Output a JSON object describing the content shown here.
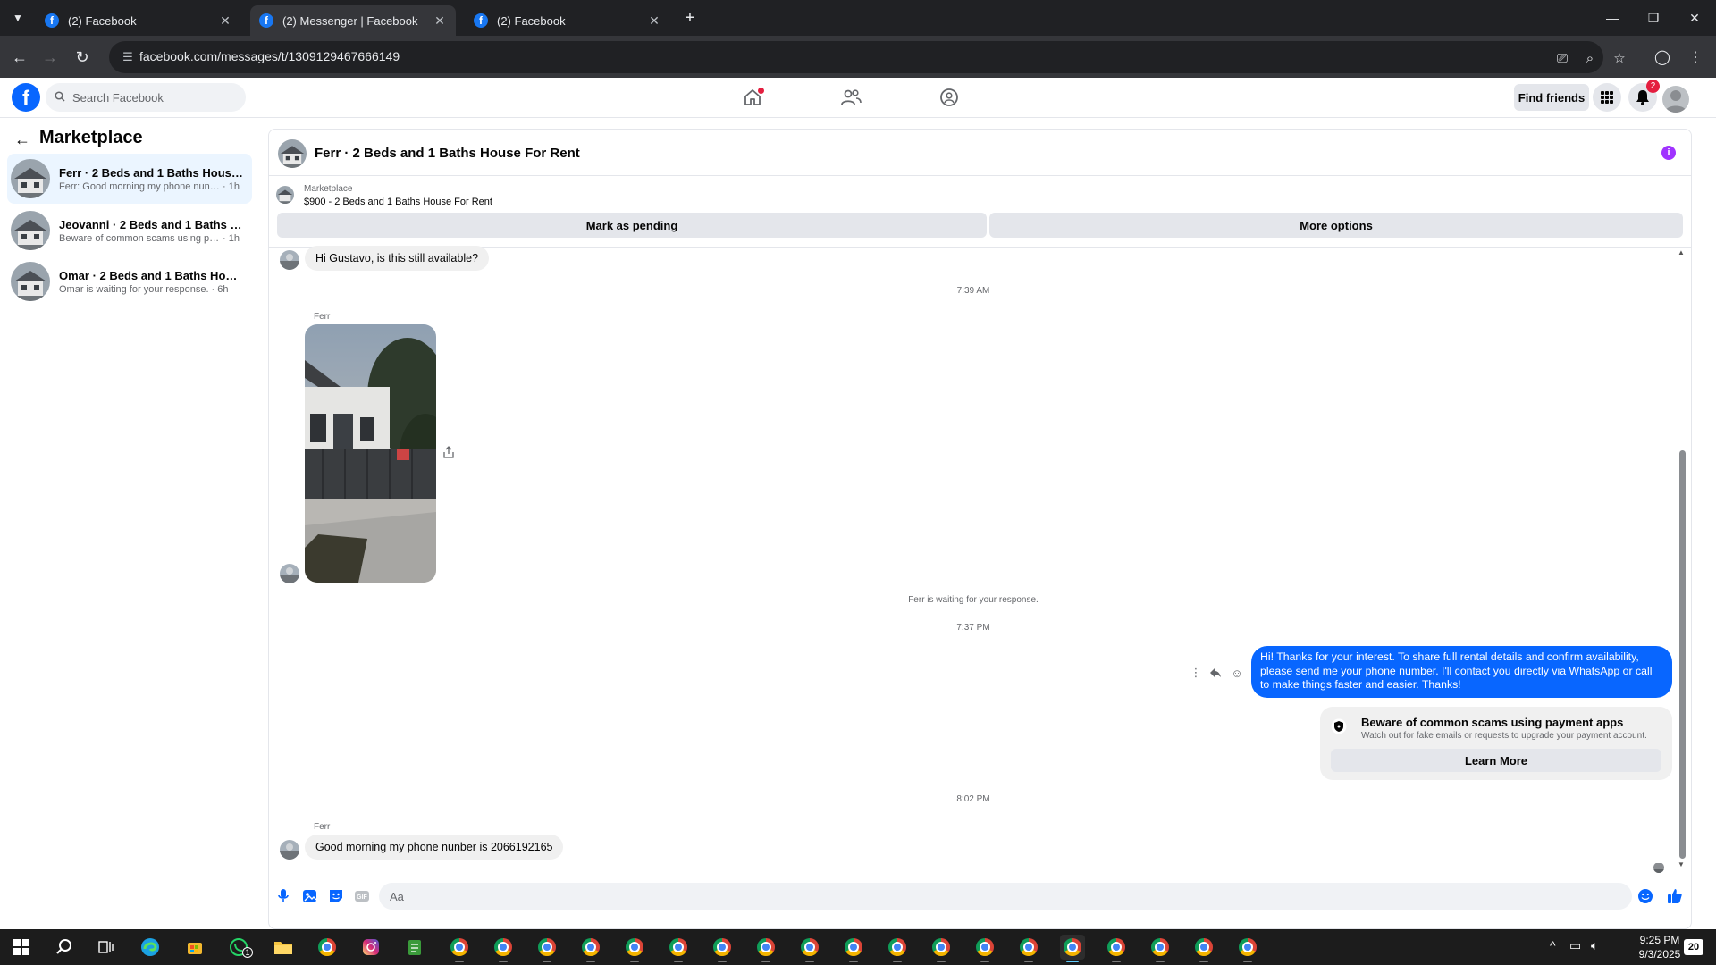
{
  "browser": {
    "tabs": [
      {
        "title": "(2) Facebook",
        "active": false
      },
      {
        "title": "(2) Messenger | Facebook",
        "active": true
      },
      {
        "title": "(2) Facebook",
        "active": false
      }
    ],
    "url": "facebook.com/messages/t/1309129467666149"
  },
  "fb_header": {
    "search_placeholder": "Search Facebook",
    "find_friends_label": "Find friends",
    "notification_count": "2"
  },
  "sidebar": {
    "title": "Marketplace",
    "conversations": [
      {
        "title": "Ferr · 2 Beds and 1 Baths House Fo...",
        "preview": "Ferr: Good morning my phone nunbe...",
        "time": "· 1h",
        "active": true
      },
      {
        "title": "Jeovanni · 2 Beds and 1 Baths Hou...",
        "preview": "Beware of common scams using pay...",
        "time": "· 1h",
        "active": false
      },
      {
        "title": "Omar · 2 Beds and 1 Baths House F...",
        "preview": "Omar is waiting for your response.",
        "time": "· 6h",
        "active": false
      }
    ]
  },
  "chat": {
    "header_title": "Ferr · 2 Beds and 1 Baths House For Rent",
    "marketplace_label": "Marketplace",
    "listing": "$900 - 2 Beds and 1 Baths House For Rent",
    "mark_pending_label": "Mark as pending",
    "more_options_label": "More options",
    "messages": {
      "first_incoming": "Hi Gustavo, is this still available?",
      "time_1": "7:39 AM",
      "photo_sender": "Ferr",
      "waiting_note": "Ferr is waiting for your response.",
      "time_2": "7:37 PM",
      "outgoing": "Hi! Thanks for your interest. To share full rental details and confirm availability, please send me your phone number. I'll contact you directly via WhatsApp or call to make things faster and easier. Thanks!",
      "scam_title": "Beware of common scams using payment apps",
      "scam_desc": "Watch out for fake emails or requests to upgrade your payment account.",
      "learn_more": "Learn More",
      "time_3": "8:02 PM",
      "last_sender": "Ferr",
      "last_incoming": "Good morning my phone nunber is 2066192165"
    },
    "composer_placeholder": "Aa"
  },
  "taskbar": {
    "time": "9:25 PM",
    "date": "9/3/2025",
    "whatsapp_badge": "1",
    "notification_count": "20"
  },
  "colors": {
    "facebook_blue": "#0866ff",
    "outgoing_bubble": "#0866ff",
    "notification_red": "#e41e3f",
    "info_purple": "#a033ff"
  }
}
